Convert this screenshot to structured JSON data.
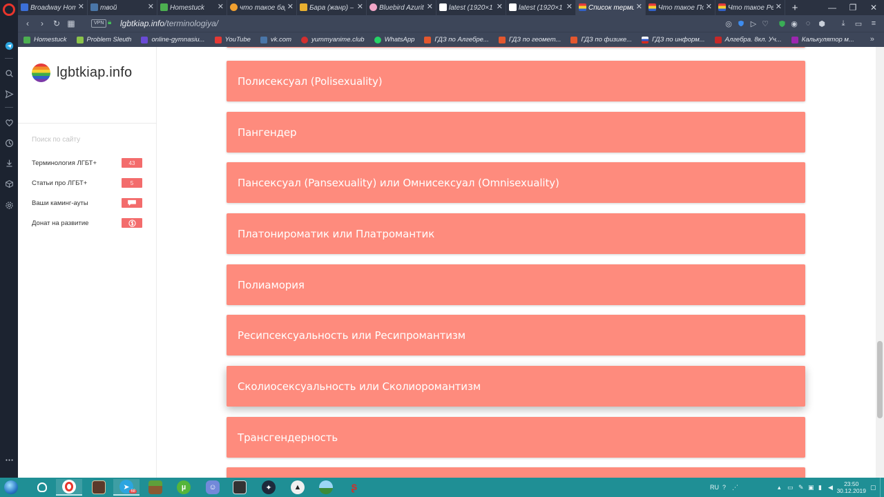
{
  "browser": {
    "tabs": [
      {
        "label": "Broadway Hom",
        "color": "#3b6fd8"
      },
      {
        "label": "твой",
        "color": "#4a76a8"
      },
      {
        "label": "Homestuck",
        "color": "#4caf50"
      },
      {
        "label": "что такое бар",
        "color": "#f0a030"
      },
      {
        "label": "Бара (жанр) –",
        "color": "#e8b030"
      },
      {
        "label": "Bluebird Azurit",
        "color": "#f2a6c8"
      },
      {
        "label": "latest (1920×1",
        "color": "#ffffff"
      },
      {
        "label": "latest (1920×1",
        "color": "#ffffff"
      },
      {
        "label": "Список терми",
        "color": "#e53b3b",
        "active": true
      },
      {
        "label": "Что такое По",
        "color": "#e53b3b"
      },
      {
        "label": "Что такое Ре",
        "color": "#e53b3b"
      }
    ],
    "address": {
      "vpn_label": "VPN",
      "domain": "lgbtkiap.info",
      "path": "/terminologiya/"
    },
    "bookmarks": [
      {
        "label": "Homestuck",
        "color": "#4caf50"
      },
      {
        "label": "Problem Sleuth",
        "color": "#8bc34a"
      },
      {
        "label": "online-gymnasiu...",
        "color": "#6a4bd6"
      },
      {
        "label": "YouTube",
        "color": "#e53935"
      },
      {
        "label": "vk.com",
        "color": "#4a76a8"
      },
      {
        "label": "yummyanime.club",
        "color": "#d32f2f"
      },
      {
        "label": "WhatsApp",
        "color": "#25d366"
      },
      {
        "label": "ГДЗ по Алгебре...",
        "color": "#e4572e"
      },
      {
        "label": "ГДЗ по геомет...",
        "color": "#e4572e"
      },
      {
        "label": "ГДЗ по физике...",
        "color": "#e4572e"
      },
      {
        "label": "ГДЗ по информ...",
        "color": "#d32f2f"
      },
      {
        "label": "Алгебра. 8кл. Уч...",
        "color": "#c62828"
      },
      {
        "label": "Калькулятор м...",
        "color": "#9c27b0"
      }
    ]
  },
  "site": {
    "brand": "lgbtkiap.info",
    "search_placeholder": "Поиск по сайту",
    "menu": [
      {
        "label": "Терминология ЛГБТ+",
        "badge": "43"
      },
      {
        "label": "Статьи про ЛГБТ+",
        "badge": "5"
      },
      {
        "label": "Ваши каминг-ауты",
        "badge_icon": "chat-bubble-icon"
      },
      {
        "label": "Донат на развитие",
        "badge_icon": "coin-icon"
      }
    ],
    "terms": [
      "Полисексуал (Polisexuality)",
      "Пангендер",
      "Пансексуал (Pansexuality) или Омнисексуал (Omnisexuality)",
      "Платонироматик или Платромантик",
      "Полиамория",
      "Ресипсексуальность или Ресипромантизм",
      "Сколиосексуальность или Сколиоромантизм",
      "Трансгендерность"
    ],
    "card_color": "#fe8b7d",
    "badge_color": "#f36c6c"
  },
  "taskbar": {
    "tray_lang": "RU",
    "clock_time": "23:50",
    "clock_date": "30.12.2019",
    "telegram_badge": "68"
  }
}
